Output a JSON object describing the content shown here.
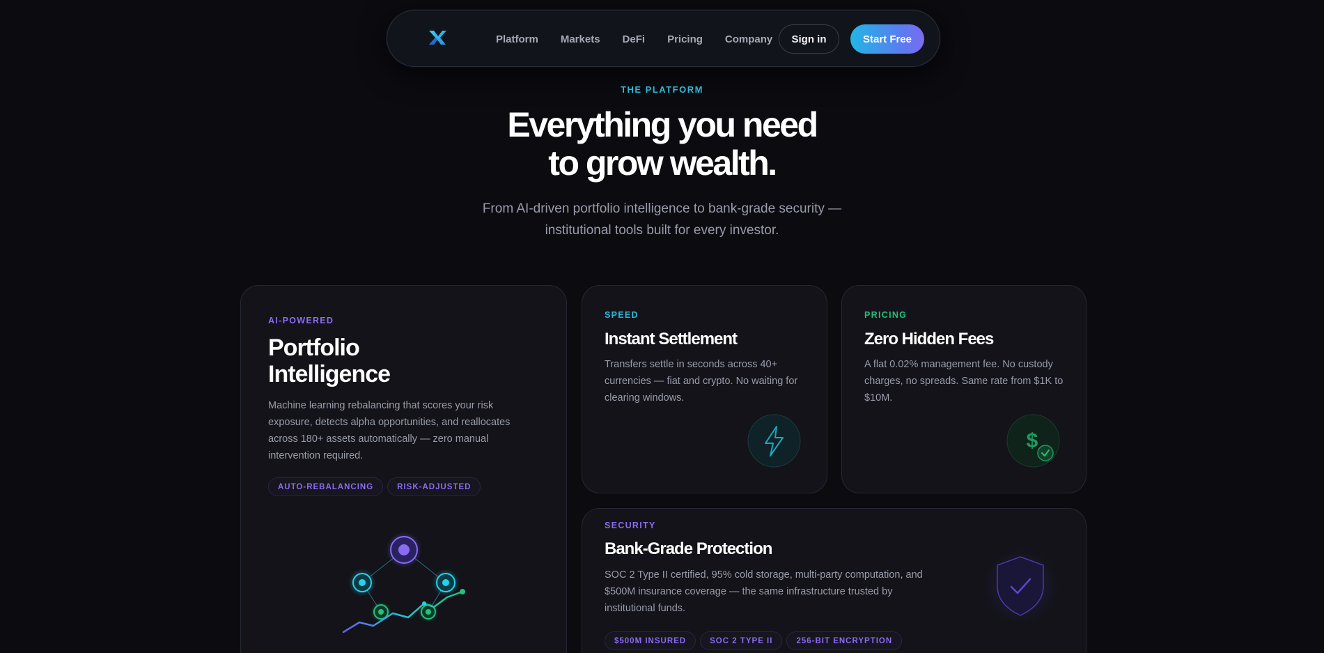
{
  "nav": {
    "logo_icon": "x-logo-icon",
    "links": [
      "Platform",
      "Markets",
      "DeFi",
      "Pricing",
      "Company"
    ],
    "signin_label": "Sign in",
    "cta_label": "Start Free"
  },
  "hero": {
    "eyebrow": "THE PLATFORM",
    "headline_line1": "Everything you need",
    "headline_line2": "to grow wealth.",
    "subtitle_line1": "From AI-driven portfolio intelligence to bank-grade security —",
    "subtitle_line2": "institutional tools built for every investor."
  },
  "cards": {
    "portfolio": {
      "tag": "AI-POWERED",
      "title_line1": "Portfolio",
      "title_line2": "Intelligence",
      "description": "Machine learning rebalancing that scores your risk exposure, detects alpha opportunities, and reallocates across 180+ assets automatically — zero manual intervention required.",
      "chips": [
        "AUTO-REBALANCING",
        "RISK-ADJUSTED"
      ],
      "illustration": "neural-network-chart-icon"
    },
    "speed": {
      "tag": "SPEED",
      "title": "Instant Settlement",
      "description": "Transfers settle in seconds across 40+ currencies — fiat and crypto. No waiting for clearing windows.",
      "icon": "lightning-bolt-icon"
    },
    "pricing": {
      "tag": "PRICING",
      "title": "Zero Hidden Fees",
      "description": "A flat 0.02% management fee. No custody charges, no spreads. Same rate from $1K to $10M.",
      "icon": "dollar-check-icon"
    },
    "security": {
      "tag": "SECURITY",
      "title": "Bank-Grade Protection",
      "description_line1": "SOC 2 Type II certified, 95% cold storage, multi-party computation, and",
      "description_line2": "$500M insurance coverage — the same infrastructure trusted by",
      "description_line3": "institutional funds.",
      "chips": [
        "$500M INSURED",
        "SOC 2 TYPE II",
        "256-BIT ENCRYPTION"
      ],
      "icon": "shield-check-icon"
    }
  },
  "colors": {
    "background": "#0b0b10",
    "cyan_accent": "#2fb9d6",
    "purple_accent": "#8a6cf2",
    "green_accent": "#22c27a"
  }
}
